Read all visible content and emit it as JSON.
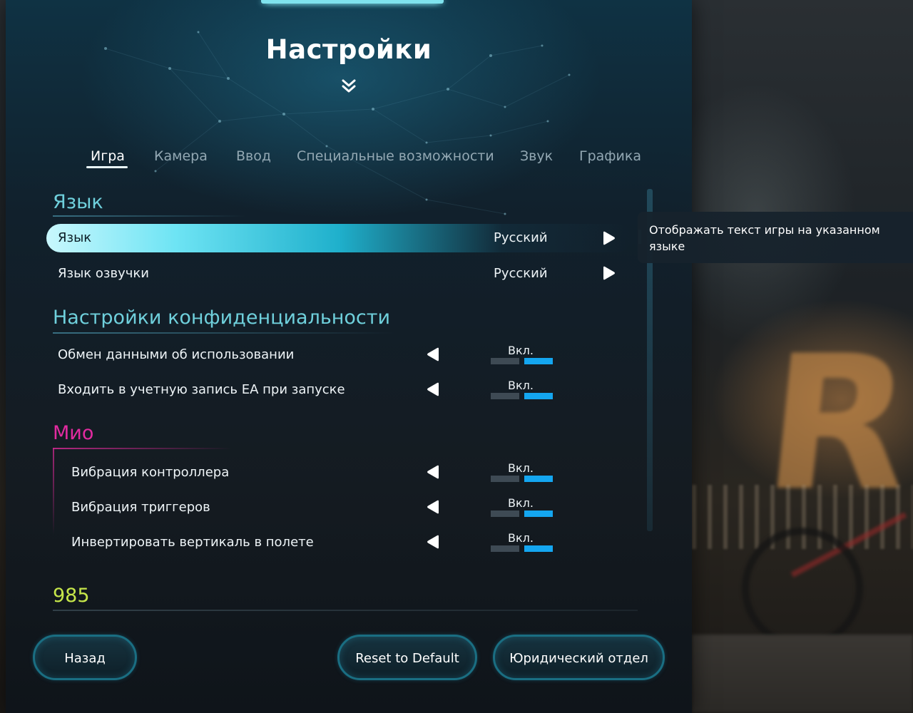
{
  "header": {
    "title": "Настройки",
    "chevron_icon": "double-chevron-down-icon"
  },
  "tabs": [
    {
      "label": "Игра",
      "active": true
    },
    {
      "label": "Камера",
      "active": false
    },
    {
      "label": "Ввод",
      "active": false
    },
    {
      "label": "Специальные возможности",
      "active": false
    },
    {
      "label": "Звук",
      "active": false
    },
    {
      "label": "Графика",
      "active": false
    }
  ],
  "sections": {
    "language": {
      "title": "Язык",
      "rows": [
        {
          "label": "Язык",
          "value": "Русский",
          "selected": true
        },
        {
          "label": "Язык озвучки",
          "value": "Русский",
          "selected": false
        }
      ]
    },
    "privacy": {
      "title": "Настройки конфиденциальности",
      "rows": [
        {
          "label": "Обмен данными об использовании",
          "value": "Вкл."
        },
        {
          "label": "Входить в учетную запись EA при запуске",
          "value": "Вкл."
        }
      ]
    },
    "mio": {
      "title": "Мио",
      "rows": [
        {
          "label": "Вибрация контроллера",
          "value": "Вкл."
        },
        {
          "label": "Вибрация триггеров",
          "value": "Вкл."
        },
        {
          "label": "Инвертировать вертикаль в полете",
          "value": "Вкл."
        }
      ]
    }
  },
  "tooltip": {
    "text": "Отображать текст игры на указанном языке"
  },
  "footer": {
    "counter": "985",
    "back_label": "Назад",
    "reset_label": "Reset to Default",
    "legal_label": "Юридический отдел"
  },
  "colors": {
    "accent_cyan": "#6fd0dc",
    "accent_pink": "#e22ba0",
    "toggle_on": "#14a6f0",
    "counter": "#c6e64a"
  }
}
